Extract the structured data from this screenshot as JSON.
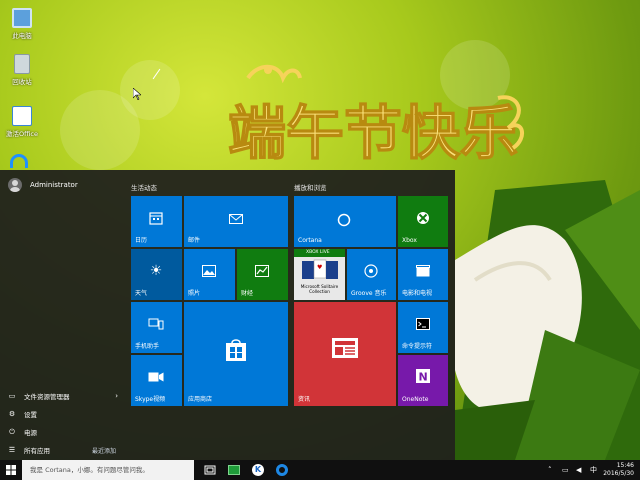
{
  "desktop": {
    "icons": [
      {
        "label": "此电脑",
        "icon": "computer-icon"
      },
      {
        "label": "回收站",
        "icon": "recycle-bin-icon"
      },
      {
        "label": "激活Office",
        "icon": "office-activate-icon"
      }
    ]
  },
  "wallpaper": {
    "greeting_text": "端午节快乐"
  },
  "start_menu": {
    "user": {
      "name": "Administrator"
    },
    "items": [
      {
        "label": "文件资源管理器",
        "icon": "folder-icon",
        "has_submenu": true
      },
      {
        "label": "设置",
        "icon": "gear-icon",
        "has_submenu": false
      },
      {
        "label": "电源",
        "icon": "power-icon",
        "has_submenu": false
      },
      {
        "label": "所有应用",
        "icon": "all-apps-icon",
        "has_submenu": false
      }
    ],
    "recently_added": "最近添加",
    "groups": [
      {
        "title": "生活动态"
      },
      {
        "title": "播放和浏览"
      }
    ],
    "tiles": {
      "calendar": "日历",
      "mail": "邮件",
      "weather": "天气",
      "photos": "照片",
      "money": "财经",
      "phone": "手机助手",
      "skype": "Skype视频",
      "store": "应用商店",
      "cortana": "Cortana",
      "xbox": "Xbox",
      "solitaire_badge": "XBOX LIVE",
      "solitaire_name": "Microsoft Solitaire Collection",
      "groove": "Groove 音乐",
      "movies": "电影和电视",
      "cmd": "命令提示符",
      "news": "资讯",
      "onenote": "OneNote"
    }
  },
  "taskbar": {
    "search_placeholder": "我是 Cortana，小娜。有问题尽管问我。",
    "clock_time": "15:46",
    "clock_date": "2016/5/30"
  },
  "colors": {
    "tile_blue": "#0078d7",
    "tile_dark_blue": "#005a9e",
    "tile_green": "#107c10",
    "tile_red": "#d13438",
    "tile_purple": "#7719aa",
    "start_bg": "#1c1c1c"
  }
}
